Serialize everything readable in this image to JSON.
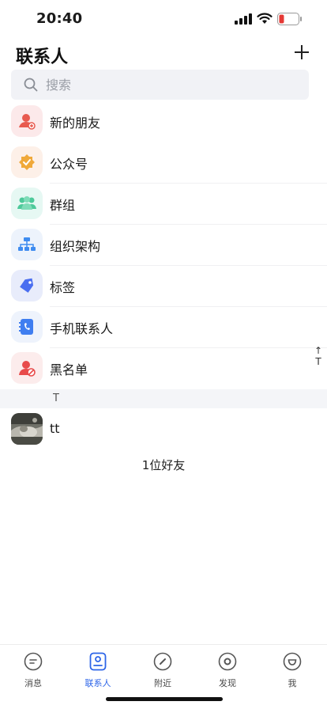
{
  "status_bar": {
    "time": "20:40",
    "icons": [
      "signal-icon",
      "wifi-icon",
      "battery-low-icon"
    ]
  },
  "header": {
    "title": "联系人",
    "add_icon": "plus-icon"
  },
  "search": {
    "placeholder": "搜索",
    "icon": "search-icon"
  },
  "menu": {
    "items": [
      {
        "label": "新的朋友",
        "icon": "new-friend-icon",
        "color": "#e85a4f",
        "bg": "#fce9ea"
      },
      {
        "label": "公众号",
        "icon": "official-account-icon",
        "color": "#f0a93a",
        "bg": "#fdf0e8"
      },
      {
        "label": "群组",
        "icon": "group-icon",
        "color": "#4dc99a",
        "bg": "#e6f8f3"
      },
      {
        "label": "组织架构",
        "icon": "org-chart-icon",
        "color": "#3f8cf0",
        "bg": "#edf3fc"
      },
      {
        "label": "标签",
        "icon": "tag-icon",
        "color": "#4a6ef0",
        "bg": "#e8ecfb"
      },
      {
        "label": "手机联系人",
        "icon": "phone-contacts-icon",
        "color": "#3f7ef0",
        "bg": "#eef3fc"
      },
      {
        "label": "黑名单",
        "icon": "blacklist-icon",
        "color": "#e84a4a",
        "bg": "#fcecec"
      }
    ]
  },
  "side_index": {
    "arrow": "↑",
    "letter": "T"
  },
  "section": {
    "letter": "T"
  },
  "contacts": [
    {
      "name": "tt",
      "avatar": "photo-avatar"
    }
  ],
  "friend_count": "1位好友",
  "tab_bar": {
    "tabs": [
      {
        "label": "消息",
        "icon": "message-icon",
        "active": false
      },
      {
        "label": "联系人",
        "icon": "contacts-icon",
        "active": true
      },
      {
        "label": "附近",
        "icon": "nearby-icon",
        "active": false
      },
      {
        "label": "发现",
        "icon": "discover-icon",
        "active": false
      },
      {
        "label": "我",
        "icon": "me-icon",
        "active": false
      }
    ],
    "active_color": "#2d65e8"
  }
}
